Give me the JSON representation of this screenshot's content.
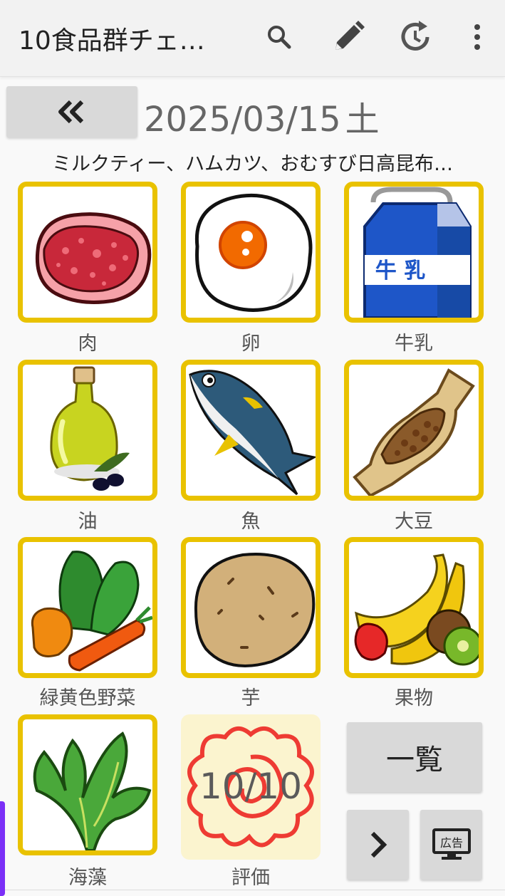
{
  "app": {
    "title": "10食品群チェ…",
    "actions": [
      {
        "name": "search-icon"
      },
      {
        "name": "edit-icon"
      },
      {
        "name": "history-icon"
      },
      {
        "name": "more-vert-icon"
      }
    ]
  },
  "date_nav": {
    "prev_icon": "double-chevron-left-icon",
    "date": "2025/03/15",
    "weekday": "土"
  },
  "menu_text": "ミルクティー、ハムカツ、おむすび日高昆布…",
  "food_groups": [
    {
      "label": "肉",
      "icon": "meat-icon",
      "checked": true
    },
    {
      "label": "卵",
      "icon": "egg-icon",
      "checked": true
    },
    {
      "label": "牛乳",
      "icon": "milk-icon",
      "checked": true,
      "carton_text": "牛 乳"
    },
    {
      "label": "油",
      "icon": "oil-icon",
      "checked": true
    },
    {
      "label": "魚",
      "icon": "fish-icon",
      "checked": true
    },
    {
      "label": "大豆",
      "icon": "natto-icon",
      "checked": true
    },
    {
      "label": "緑黄色野菜",
      "icon": "vegetables-icon",
      "checked": true
    },
    {
      "label": "芋",
      "icon": "potato-icon",
      "checked": true
    },
    {
      "label": "果物",
      "icon": "fruit-icon",
      "checked": true
    },
    {
      "label": "海藻",
      "icon": "seaweed-icon",
      "checked": true
    }
  ],
  "evaluation": {
    "score": "10/10",
    "label": "評価",
    "icon": "flower-stamp-icon"
  },
  "buttons": {
    "list_label": "一覧",
    "next_icon": "chevron-right-icon",
    "ad_icon": "ad-monitor-icon",
    "ad_text": "広告"
  },
  "colors": {
    "tile_border": "#e9c200",
    "score_bg": "#fbf4cf",
    "stamp_red": "#ee3b33"
  }
}
